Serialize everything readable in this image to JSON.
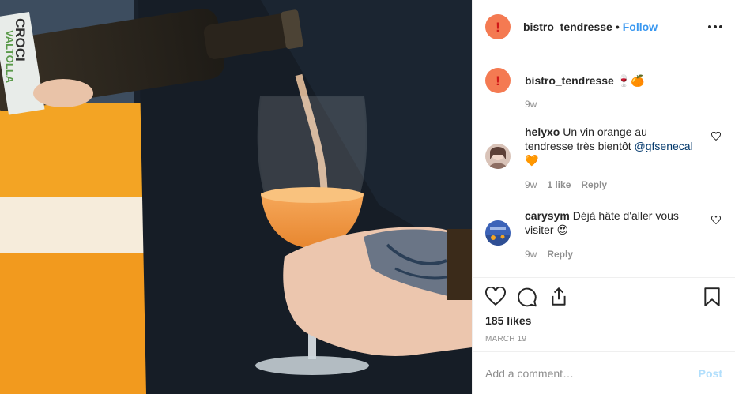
{
  "post": {
    "author": "bistro_tendresse",
    "separator": "•",
    "follow_label": "Follow",
    "likes": "185 likes",
    "date": "MARCH 19"
  },
  "photo": {
    "bottle_label_top": "CROCI",
    "bottle_label_bottom": "VALTOLLA"
  },
  "caption": {
    "username": "bistro_tendresse",
    "emoji": "🍷🍊",
    "time": "9w"
  },
  "comments": [
    {
      "username": "helyxo",
      "text": "Un vin orange au tendresse très bientôt",
      "mention": "@gfsenecal",
      "emoji": "🧡",
      "time": "9w",
      "likes": "1 like",
      "reply_label": "Reply"
    },
    {
      "username": "carysym",
      "text": "Déjà hâte d'aller vous visiter",
      "emoji": "😍",
      "time": "9w",
      "reply_label": "Reply"
    }
  ],
  "composer": {
    "placeholder": "Add a comment…",
    "post_label": "Post"
  },
  "colors": {
    "accent": "#3897f0",
    "avatar": "#f47a52",
    "post_disabled": "#b2dffc"
  },
  "icons": [
    "heart-icon",
    "comment-icon",
    "share-icon",
    "bookmark-icon",
    "more-icon"
  ]
}
